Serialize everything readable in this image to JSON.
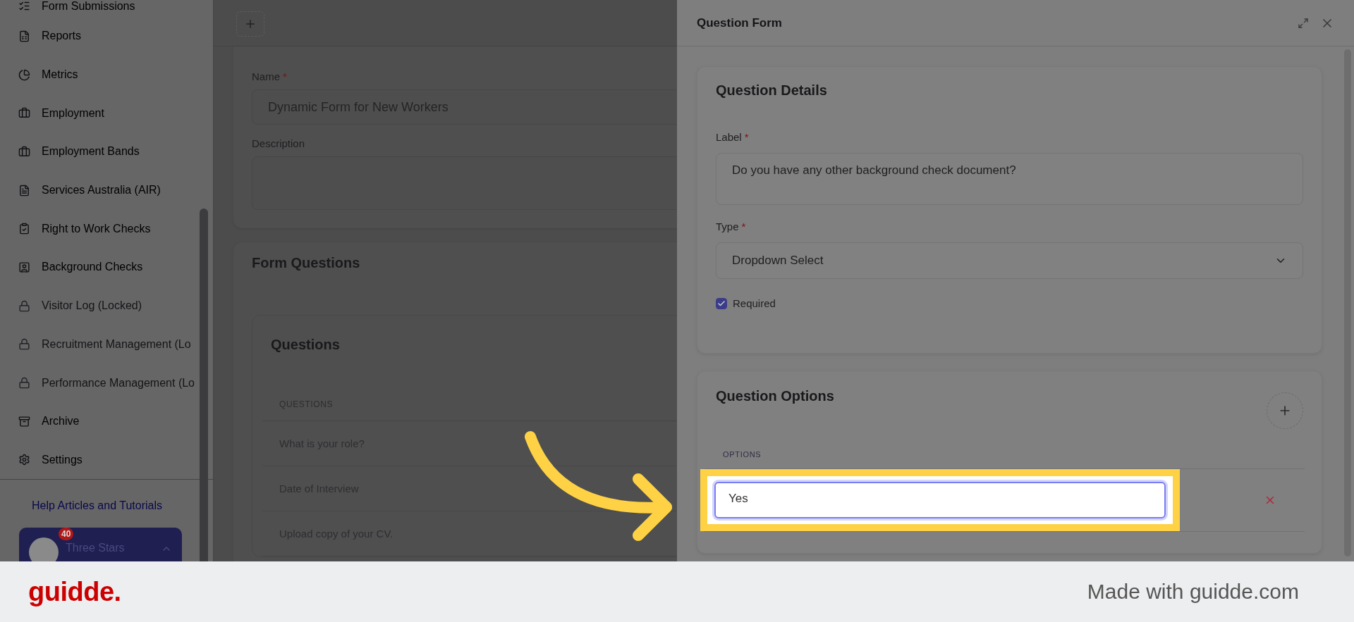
{
  "sidebar": {
    "items": [
      {
        "label": "Form Submissions",
        "locked": false
      },
      {
        "label": "Reports",
        "locked": false
      },
      {
        "label": "Metrics",
        "locked": false
      },
      {
        "label": "Employment",
        "locked": false
      },
      {
        "label": "Employment Bands",
        "locked": false
      },
      {
        "label": "Services Australia (AIR)",
        "locked": false
      },
      {
        "label": "Right to Work Checks",
        "locked": false
      },
      {
        "label": "Background Checks",
        "locked": false
      },
      {
        "label": "Visitor Log (Locked)",
        "locked": true
      },
      {
        "label": "Recruitment Management (Lo",
        "locked": true
      },
      {
        "label": "Performance Management (Lo",
        "locked": true
      },
      {
        "label": "Archive",
        "locked": false
      },
      {
        "label": "Settings",
        "locked": false
      }
    ],
    "help_link": "Help Articles and Tutorials",
    "account": {
      "name": "Three Stars",
      "badge": "40"
    }
  },
  "form": {
    "name_label": "Name",
    "name_required": "*",
    "name_value": "Dynamic Form for New Workers",
    "description_label": "Description",
    "questions_title": "Form Questions",
    "questions_card_title": "Questions",
    "column": "QUESTIONS",
    "rows": [
      "What is your role?",
      "Date of Interview",
      "Upload copy of your CV."
    ]
  },
  "drawer": {
    "title": "Question Form",
    "details_title": "Question Details",
    "label_label": "Label",
    "label_required": "*",
    "label_value": "Do you have any other background check document?",
    "type_label": "Type",
    "type_required": "*",
    "type_value": "Dropdown Select",
    "required_label": "Required",
    "required_checked": true,
    "options_title": "Question Options",
    "options_column": "OPTIONS",
    "options": [
      "Yes"
    ]
  },
  "footer": {
    "logo": "guidde.",
    "credit": "Made with guidde.com"
  }
}
